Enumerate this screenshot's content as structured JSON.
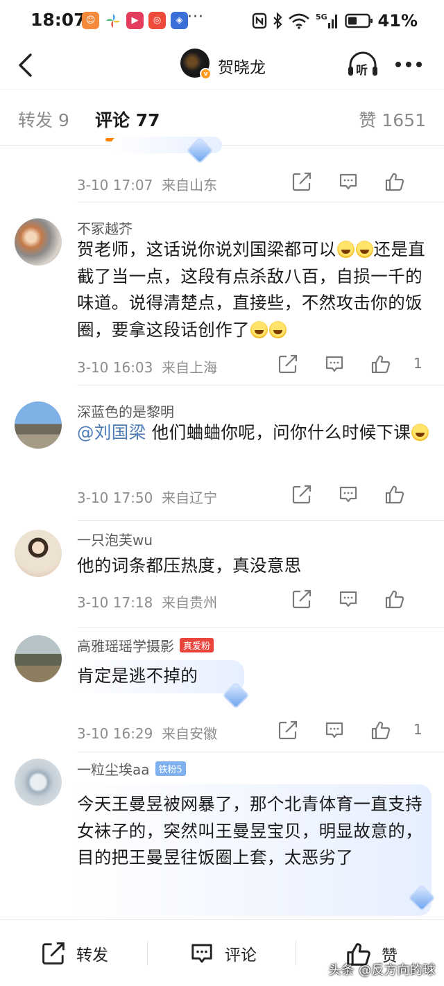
{
  "status_bar": {
    "time": "18:07",
    "more": "···",
    "battery": "41%",
    "network": "5G",
    "app_icons": [
      "taobao-icon",
      "pinwheel-icon",
      "video-icon",
      "camera-icon",
      "shield-app-icon"
    ]
  },
  "header": {
    "author_name": "贺晓龙",
    "listen_label": "听"
  },
  "tabs": {
    "repost": "转发 9",
    "comment": "评论 77",
    "like": "赞 1651",
    "active": "comment",
    "accent_color": "#ff8200"
  },
  "comments": [
    {
      "username": "",
      "text": "",
      "time": "3-10 17:07",
      "location": "来自山东",
      "likes": ""
    },
    {
      "username": "不冢越芥",
      "text_parts": [
        "贺老师，这话说你说刘国梁都可以",
        "还是直截了当一点，这段有点杀敌八百，自损一千的味道。说得清楚点，直接些，不然攻击你的饭圈，要拿这段话创作了",
        ""
      ],
      "time": "3-10 16:03",
      "location": "来自上海",
      "likes": "1"
    },
    {
      "username": "深蓝色的是黎明",
      "mention": "@刘国梁",
      "text": " 他们蛐蛐你呢，问你什么时候下课",
      "time": "3-10 17:50",
      "location": "来自辽宁",
      "likes": ""
    },
    {
      "username": "一只泡芙wu",
      "text": "他的词条都压热度，真没意思",
      "time": "3-10 17:18",
      "location": "来自贵州",
      "likes": ""
    },
    {
      "username": "高雅瑶瑶学摄影",
      "badge": "真爱粉",
      "text": "肯定是逃不掉的",
      "time": "3-10 16:29",
      "location": "来自安徽",
      "likes": "1"
    },
    {
      "username": "一粒尘埃aa",
      "badge": "铁粉5",
      "text": "今天王曼昱被网暴了，那个北青体育一直支持女袜子的，突然叫王曼昱宝贝，明显故意的，目的把王曼昱往饭圈上套，太恶劣了"
    }
  ],
  "bottom_bar": {
    "repost": "转发",
    "comment": "评论",
    "like": "赞"
  },
  "watermark": "头条 @反方向的球"
}
